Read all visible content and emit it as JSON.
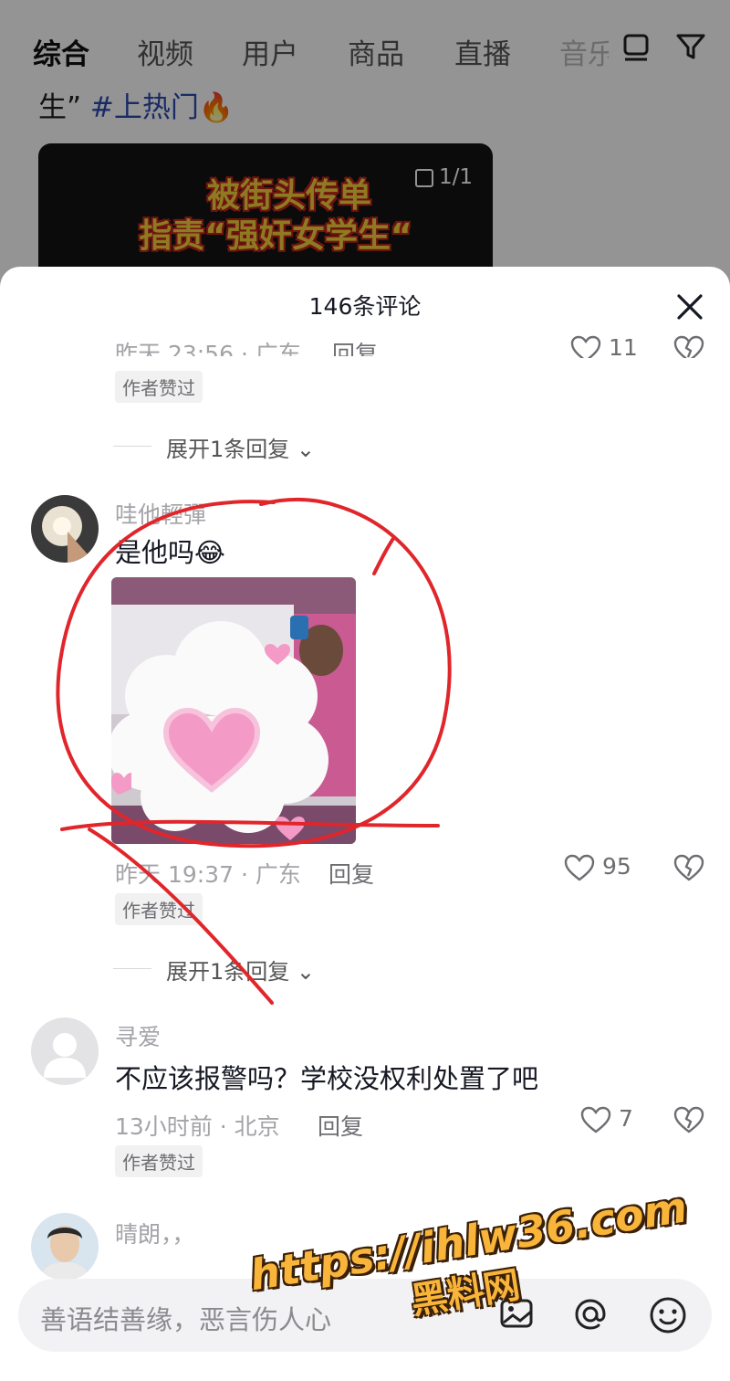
{
  "search_tabs": {
    "items": [
      "综合",
      "视频",
      "用户",
      "商品",
      "直播",
      "音乐"
    ],
    "active": "综合"
  },
  "background": {
    "caption_text": "生”",
    "caption_tag": "#上热门",
    "caption_emoji": "🔥",
    "video_overlay_line1": "被街头传单",
    "video_overlay_line2": "指责“强奸女学生“",
    "video_count": "1/1"
  },
  "comments_sheet": {
    "title": "146条评论",
    "comments": [
      {
        "time_location": "昨天 23:56 · 广东",
        "reply_label": "回复",
        "likes": "11",
        "badge": "作者赞过",
        "expand_label": "展开1条回复"
      },
      {
        "username": "哇他輕彈",
        "text": "是他吗😂",
        "time_location": "昨天 19:37 · 广东",
        "reply_label": "回复",
        "likes": "95",
        "badge": "作者赞过",
        "expand_label": "展开1条回复"
      },
      {
        "username": "寻爱",
        "text": "不应该报警吗？学校没权利处置了吧",
        "time_location": "13小时前 · 北京",
        "reply_label": "回复",
        "likes": "7",
        "badge": "作者赞过"
      },
      {
        "username": "晴朗，，"
      }
    ]
  },
  "input": {
    "placeholder": "善语结善缘，恶言伤人心"
  },
  "watermark": {
    "url": "https://ihlw36.com",
    "name": "黑料网"
  },
  "colors": {
    "annotation_red": "#e0262b",
    "badge_bg": "#f1f1f2",
    "hashtag": "#2c4bb0"
  }
}
